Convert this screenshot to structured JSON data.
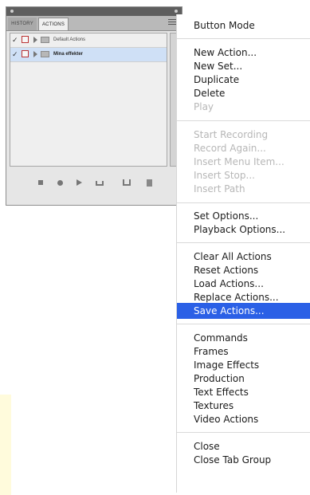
{
  "panel": {
    "tabs": [
      {
        "label": "HISTORY"
      },
      {
        "label": "ACTIONS"
      }
    ],
    "rows": [
      {
        "label": "Default Actions",
        "checked": true,
        "selected": false
      },
      {
        "label": "Mina effekter",
        "checked": true,
        "selected": true
      }
    ],
    "check_glyph": "✓",
    "toolbar_icons": [
      "stop-icon",
      "record-icon",
      "play-icon",
      "new-set-icon",
      "new-action-icon",
      "trash-icon"
    ]
  },
  "menu": {
    "items": [
      {
        "label": "Button Mode",
        "enabled": true
      },
      {
        "label": "New Action...",
        "enabled": true
      },
      {
        "label": "New Set...",
        "enabled": true
      },
      {
        "label": "Duplicate",
        "enabled": true
      },
      {
        "label": "Delete",
        "enabled": true
      },
      {
        "label": "Play",
        "enabled": false
      },
      {
        "label": "Start Recording",
        "enabled": false
      },
      {
        "label": "Record Again...",
        "enabled": false
      },
      {
        "label": "Insert Menu Item...",
        "enabled": false
      },
      {
        "label": "Insert Stop...",
        "enabled": false
      },
      {
        "label": "Insert Path",
        "enabled": false
      },
      {
        "label": "Set Options...",
        "enabled": true
      },
      {
        "label": "Playback Options...",
        "enabled": true
      },
      {
        "label": "Clear All Actions",
        "enabled": true
      },
      {
        "label": "Reset Actions",
        "enabled": true
      },
      {
        "label": "Load Actions...",
        "enabled": true
      },
      {
        "label": "Replace Actions...",
        "enabled": true
      },
      {
        "label": "Save Actions...",
        "enabled": true,
        "highlighted": true
      },
      {
        "label": "Commands",
        "enabled": true
      },
      {
        "label": "Frames",
        "enabled": true
      },
      {
        "label": "Image Effects",
        "enabled": true
      },
      {
        "label": "Production",
        "enabled": true
      },
      {
        "label": "Text Effects",
        "enabled": true
      },
      {
        "label": "Textures",
        "enabled": true
      },
      {
        "label": "Video Actions",
        "enabled": true
      },
      {
        "label": "Close",
        "enabled": true
      },
      {
        "label": "Close Tab Group",
        "enabled": true
      }
    ]
  },
  "colors": {
    "highlight": "#2b60e6",
    "disabled_text": "#b7b7b7",
    "selected_row": "#cfe0f6"
  }
}
